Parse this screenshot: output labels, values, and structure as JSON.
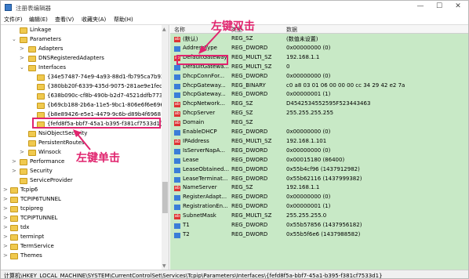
{
  "window": {
    "title": "注册表编辑器",
    "controls": [
      "—",
      "☐",
      "✕"
    ]
  },
  "menu": [
    "文件(F)",
    "编辑(E)",
    "查看(V)",
    "收藏夹(A)",
    "帮助(H)"
  ],
  "tree": [
    {
      "label": "Linkage",
      "arrow": ""
    },
    {
      "label": "Parameters",
      "arrow": "⌄"
    },
    {
      "label": "Adapters",
      "arrow": ">"
    },
    {
      "label": "DNSRegisteredAdapters",
      "arrow": ">"
    },
    {
      "label": "Interfaces",
      "arrow": "⌄"
    },
    {
      "label": "{34e57487-74e9-4a93-88d1-fb795ca7b931",
      "arrow": ""
    },
    {
      "label": "{380bb20f-6339-435d-9075-281ae9e1fec2}",
      "arrow": ""
    },
    {
      "label": "{638b090c-cf8b-490b-b2d7-4521ddfb773",
      "arrow": ""
    },
    {
      "label": "{b69cb188-2b6a-11e5-9bc1-806e6f6e6963",
      "arrow": ""
    },
    {
      "label": "{b8e89426-e5e1-4479-9c6b-d89b4f6968",
      "arrow": ""
    },
    {
      "label": "{fefd8f5a-bbf7-45a1-b395-f381cf7533d1}",
      "arrow": ""
    },
    {
      "label": "NsiObjectSecurity",
      "arrow": ""
    },
    {
      "label": "PersistentRoutes",
      "arrow": ""
    },
    {
      "label": "Winsock",
      "arrow": ">"
    },
    {
      "label": "Performance",
      "arrow": ">"
    },
    {
      "label": "Security",
      "arrow": ">"
    },
    {
      "label": "ServiceProvider",
      "arrow": ""
    },
    {
      "label": "Tcpip6",
      "arrow": ">"
    },
    {
      "label": "TCPIP6TUNNEL",
      "arrow": ">"
    },
    {
      "label": "tcpipreg",
      "arrow": ">"
    },
    {
      "label": "TCPIPTUNNEL",
      "arrow": ">"
    },
    {
      "label": "tdx",
      "arrow": ">"
    },
    {
      "label": "terminpt",
      "arrow": ">"
    },
    {
      "label": "TermService",
      "arrow": ">"
    },
    {
      "label": "Themes",
      "arrow": ">"
    }
  ],
  "list_headers": {
    "name": "名称",
    "type": "类型",
    "data": "数据"
  },
  "values": [
    {
      "icon": "ab",
      "name": "(默认)",
      "type": "REG_SZ",
      "data": "(数值未设置)"
    },
    {
      "icon": "bin",
      "name": "AddressType",
      "type": "REG_DWORD",
      "data": "0x00000000 (0)"
    },
    {
      "icon": "ab",
      "name": "DefaultGateway",
      "type": "REG_MULTI_SZ",
      "data": "192.168.1.1"
    },
    {
      "icon": "bin",
      "name": "DefaultGatewa...",
      "type": "REG_MULTI_SZ",
      "data": "0"
    },
    {
      "icon": "bin",
      "name": "DhcpConnFor...",
      "type": "REG_DWORD",
      "data": "0x00000000 (0)"
    },
    {
      "icon": "bin",
      "name": "DhcpGateway...",
      "type": "REG_BINARY",
      "data": "c0 a8 03 01 06 00 00 00 cc 34 29 42 e2 7a"
    },
    {
      "icon": "bin",
      "name": "DhcpGateway...",
      "type": "REG_DWORD",
      "data": "0x00000001 (1)"
    },
    {
      "icon": "ab",
      "name": "DhcpNetwork...",
      "type": "REG_SZ",
      "data": "D4542534552595F523443463"
    },
    {
      "icon": "ab",
      "name": "DhcpServer",
      "type": "REG_SZ",
      "data": "255.255.255.255"
    },
    {
      "icon": "ab",
      "name": "Domain",
      "type": "REG_SZ",
      "data": ""
    },
    {
      "icon": "bin",
      "name": "EnableDHCP",
      "type": "REG_DWORD",
      "data": "0x00000000 (0)"
    },
    {
      "icon": "ab",
      "name": "IPAddress",
      "type": "REG_MULTI_SZ",
      "data": "192.168.1.101"
    },
    {
      "icon": "bin",
      "name": "IsServerNapA...",
      "type": "REG_DWORD",
      "data": "0x00000000 (0)"
    },
    {
      "icon": "bin",
      "name": "Lease",
      "type": "REG_DWORD",
      "data": "0x00015180 (86400)"
    },
    {
      "icon": "bin",
      "name": "LeaseObtained...",
      "type": "REG_DWORD",
      "data": "0x55b4cf96 (1437912982)"
    },
    {
      "icon": "bin",
      "name": "LeaseTerminat...",
      "type": "REG_DWORD",
      "data": "0x55b62116 (1437999382)"
    },
    {
      "icon": "ab",
      "name": "NameServer",
      "type": "REG_SZ",
      "data": "192.168.1.1"
    },
    {
      "icon": "bin",
      "name": "RegisterAdapt...",
      "type": "REG_DWORD",
      "data": "0x00000000 (0)"
    },
    {
      "icon": "bin",
      "name": "RegistrationEn...",
      "type": "REG_DWORD",
      "data": "0x00000001 (1)"
    },
    {
      "icon": "ab",
      "name": "SubnetMask",
      "type": "REG_MULTI_SZ",
      "data": "255.255.255.0"
    },
    {
      "icon": "bin",
      "name": "T1",
      "type": "REG_DWORD",
      "data": "0x55b57856 (1437956182)"
    },
    {
      "icon": "bin",
      "name": "T2",
      "type": "REG_DWORD",
      "data": "0x55b5f6e6 (1437988582)"
    }
  ],
  "status": "计算机\\HKEY_LOCAL_MACHINE\\SYSTEM\\CurrentControlSet\\Services\\Tcpip\\Parameters\\Interfaces\\{fefd8f5a-bbf7-45a1-b395-f381cf7533d1}",
  "annotations": {
    "double_click": "左键双击",
    "single_click": "左键单击"
  },
  "colors": {
    "accent": "#e0246e",
    "list_bg": "#c8e9c6"
  }
}
